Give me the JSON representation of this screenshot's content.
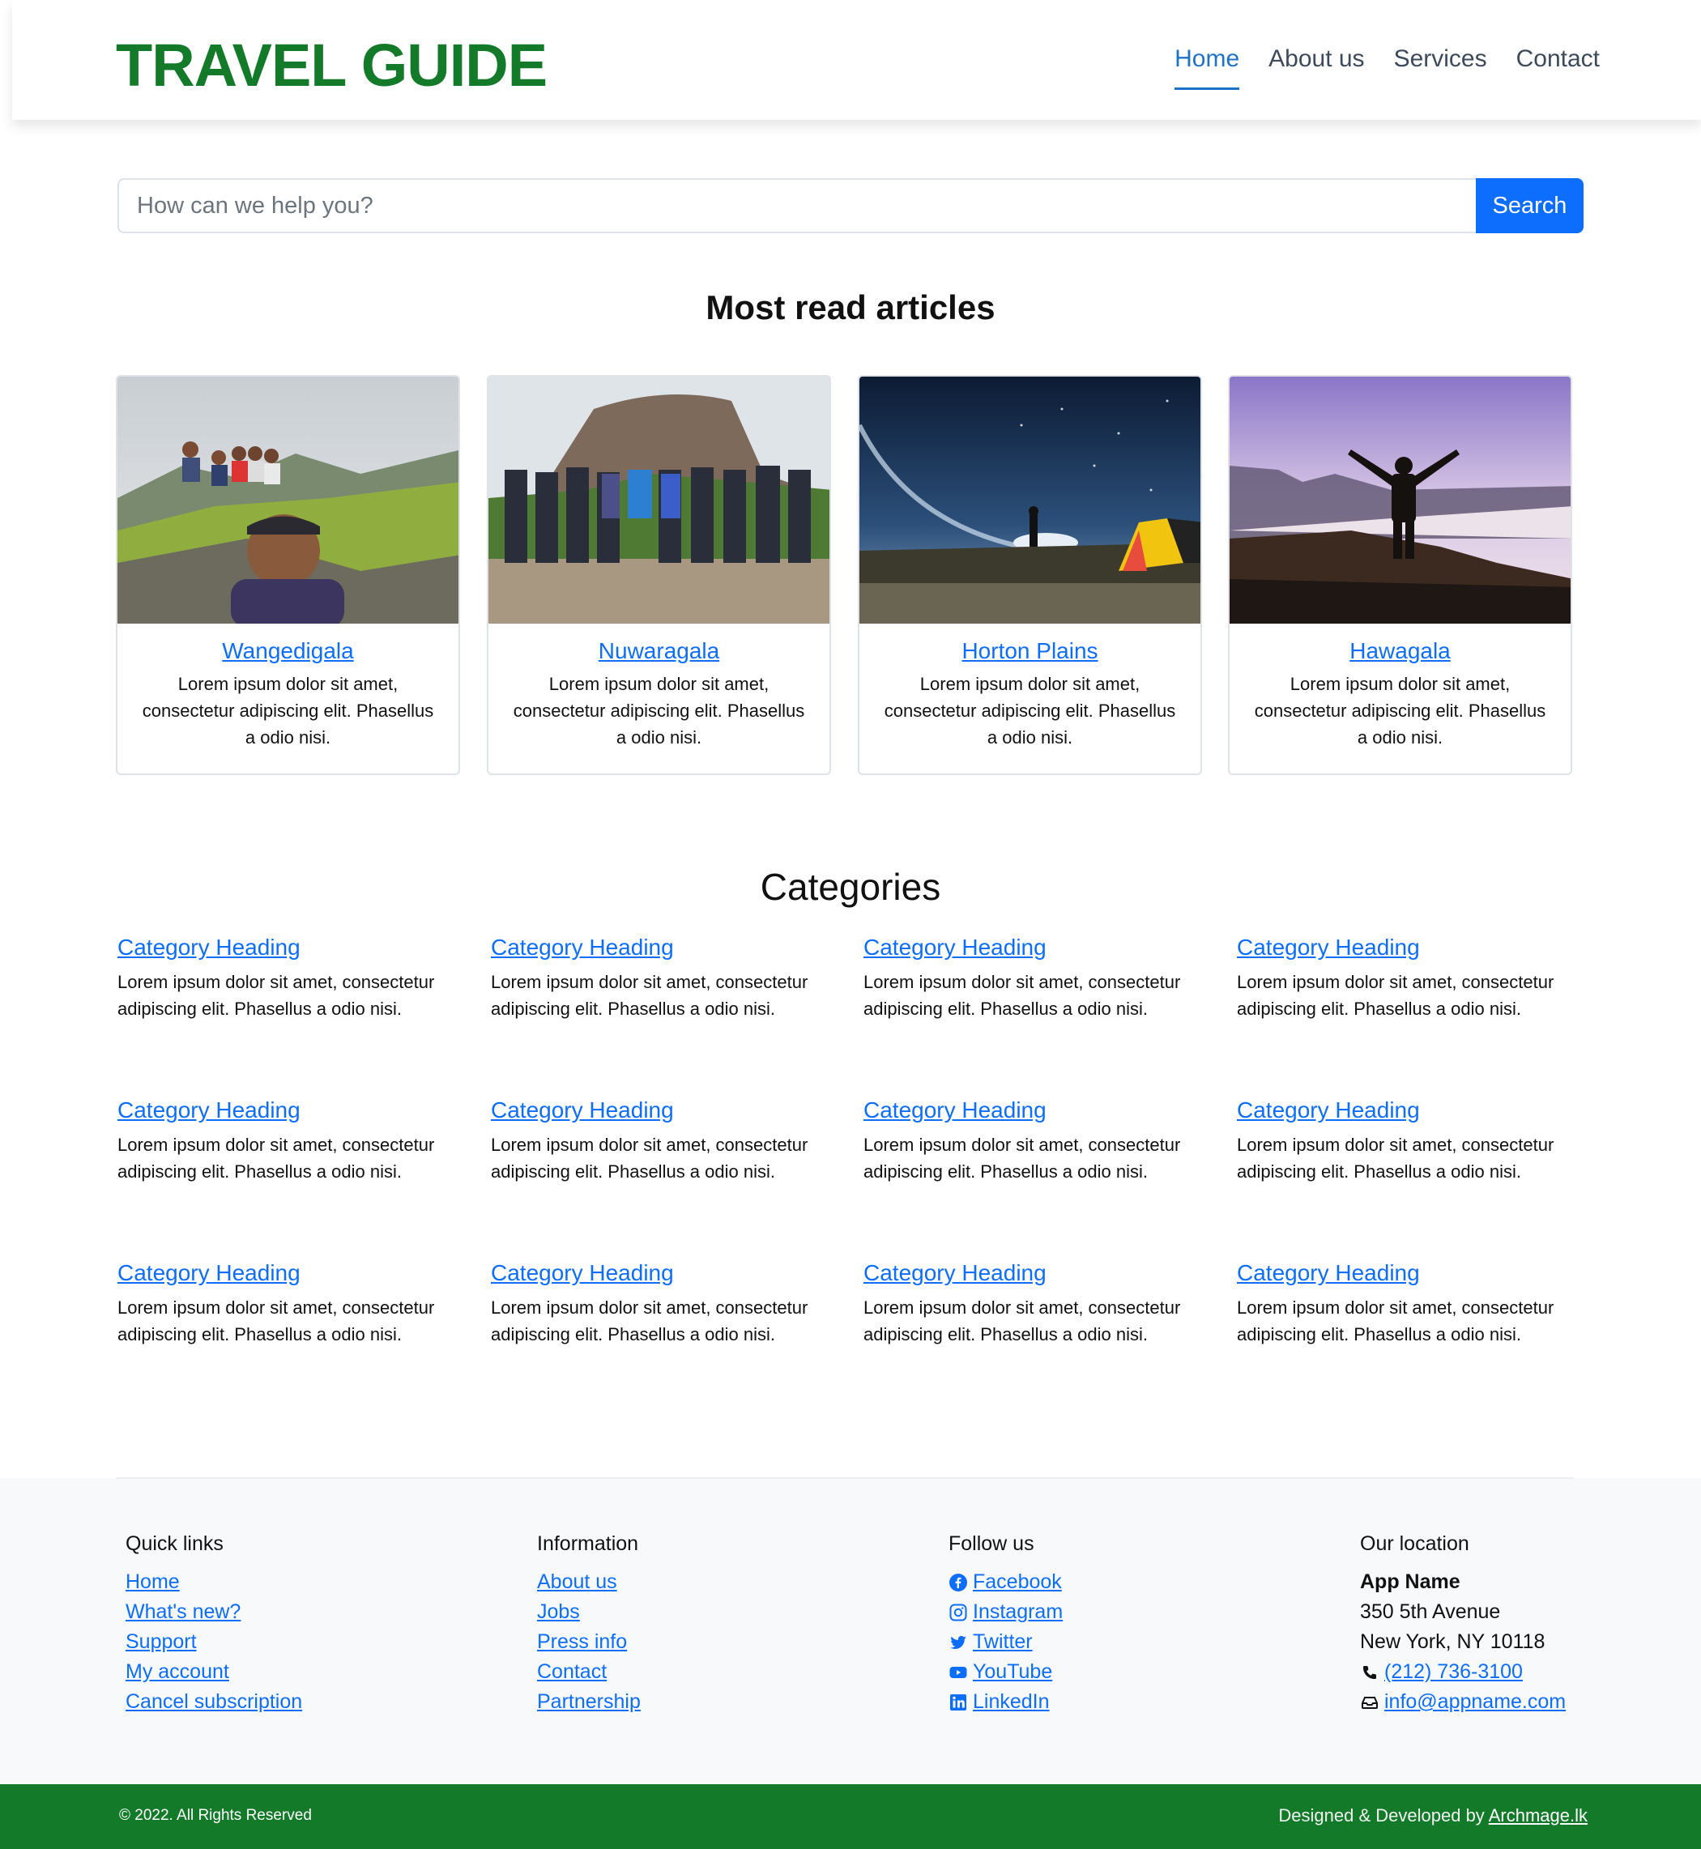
{
  "brand": "TRAVEL GUIDE",
  "nav": [
    "Home",
    "About us",
    "Services",
    "Contact"
  ],
  "search": {
    "placeholder": "How can we help you?",
    "button": "Search"
  },
  "articles_title": "Most read articles",
  "articles": [
    {
      "title": "Wangedigala",
      "text": "Lorem ipsum dolor sit amet, consectetur adipiscing elit. Phasellus a odio nisi."
    },
    {
      "title": "Nuwaragala",
      "text": "Lorem ipsum dolor sit amet, consectetur adipiscing elit. Phasellus a odio nisi."
    },
    {
      "title": "Horton Plains",
      "text": "Lorem ipsum dolor sit amet, consectetur adipiscing elit. Phasellus a odio nisi."
    },
    {
      "title": "Hawagala",
      "text": "Lorem ipsum dolor sit amet, consectetur adipiscing elit. Phasellus a odio nisi."
    }
  ],
  "categories_title": "Categories",
  "category": {
    "heading": "Category Heading",
    "text": "Lorem ipsum dolor sit amet, consectetur adipiscing elit. Phasellus a odio nisi."
  },
  "footer": {
    "quick_links": {
      "title": "Quick links",
      "items": [
        "Home",
        "What's new?",
        "Support",
        "My account",
        "Cancel subscription"
      ]
    },
    "information": {
      "title": "Information",
      "items": [
        "About us",
        "Jobs",
        "Press info",
        "Contact",
        "Partnership"
      ]
    },
    "follow": {
      "title": "Follow us",
      "items": [
        {
          "label": " Facebook",
          "icon": "facebook-icon"
        },
        {
          "label": " Instagram",
          "icon": "instagram-icon"
        },
        {
          "label": " Twitter",
          "icon": "twitter-icon"
        },
        {
          "label": " YouTube",
          "icon": "youtube-icon"
        },
        {
          "label": " LinkedIn",
          "icon": "linkedin-icon"
        }
      ]
    },
    "location": {
      "title": "Our location",
      "name": "App Name",
      "street": "350 5th Avenue",
      "city": "New York, NY 10118",
      "phone": "(212) 736-3100",
      "email": "info@appname.com"
    }
  },
  "bottom": {
    "copyright": "© 2022. All Rights Reserved",
    "credit_prefix": "Designed & Developed by ",
    "credit_link": "Archmage.lk"
  },
  "colors": {
    "brand_green": "#137a2a",
    "link_blue": "#0d6efd",
    "nav_active": "#1e73c7"
  }
}
